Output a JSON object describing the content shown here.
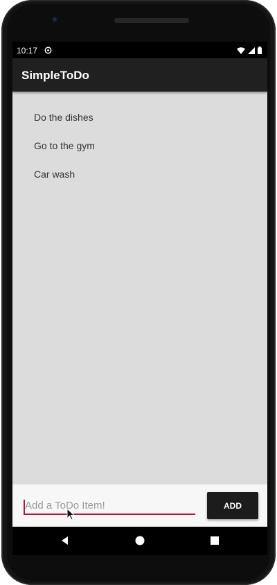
{
  "status_bar": {
    "time": "10:17",
    "icons": [
      "sync-icon",
      "wifi-icon",
      "signal-icon",
      "battery-icon"
    ]
  },
  "app_bar": {
    "title": "SimpleToDo"
  },
  "todo_list": {
    "items": [
      {
        "label": "Do the dishes"
      },
      {
        "label": "Go to the gym"
      },
      {
        "label": "Car wash"
      }
    ]
  },
  "input_bar": {
    "input_value": "",
    "input_placeholder": "Add a ToDo Item!",
    "add_button_label": "ADD"
  },
  "nav_bar": {
    "icons": [
      "back-icon",
      "home-icon",
      "recent-apps-icon"
    ]
  },
  "colors": {
    "app_bar_bg": "#202020",
    "content_bg": "#dcdcdc",
    "accent_underline": "#b0193f",
    "add_button_bg": "#1c1c1c"
  }
}
